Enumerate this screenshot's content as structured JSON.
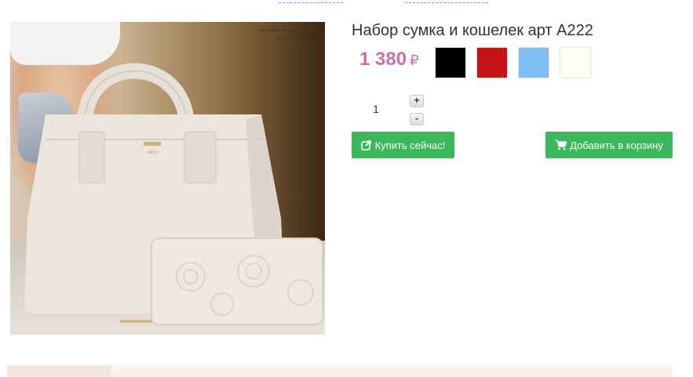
{
  "product": {
    "title": "Набор сумка и кошелек арт A222",
    "price": "1 380",
    "currency": "₽",
    "image_alt": "Набор сумка и кошелек",
    "image_caption": [
      "URBAN WOMEN ELEGANCE CLOTHES ESSENTIALS",
      "THE LIGHT OF THE TREND"
    ],
    "bag_brand": "EMPOS"
  },
  "colors": [
    {
      "name": "black",
      "hex": "#000000"
    },
    {
      "name": "red",
      "hex": "#c81414"
    },
    {
      "name": "light-blue",
      "hex": "#7fbff5"
    },
    {
      "name": "ivory",
      "hex": "#fffff3"
    }
  ],
  "quantity": {
    "value": "1",
    "plus_label": "+",
    "minus_label": "-"
  },
  "actions": {
    "buy_now_label": "Купить сейчас!",
    "add_to_cart_label": "Добавить в корзину"
  },
  "theme": {
    "price_color": "#cc6fa8",
    "button_color": "#3cb75c"
  }
}
